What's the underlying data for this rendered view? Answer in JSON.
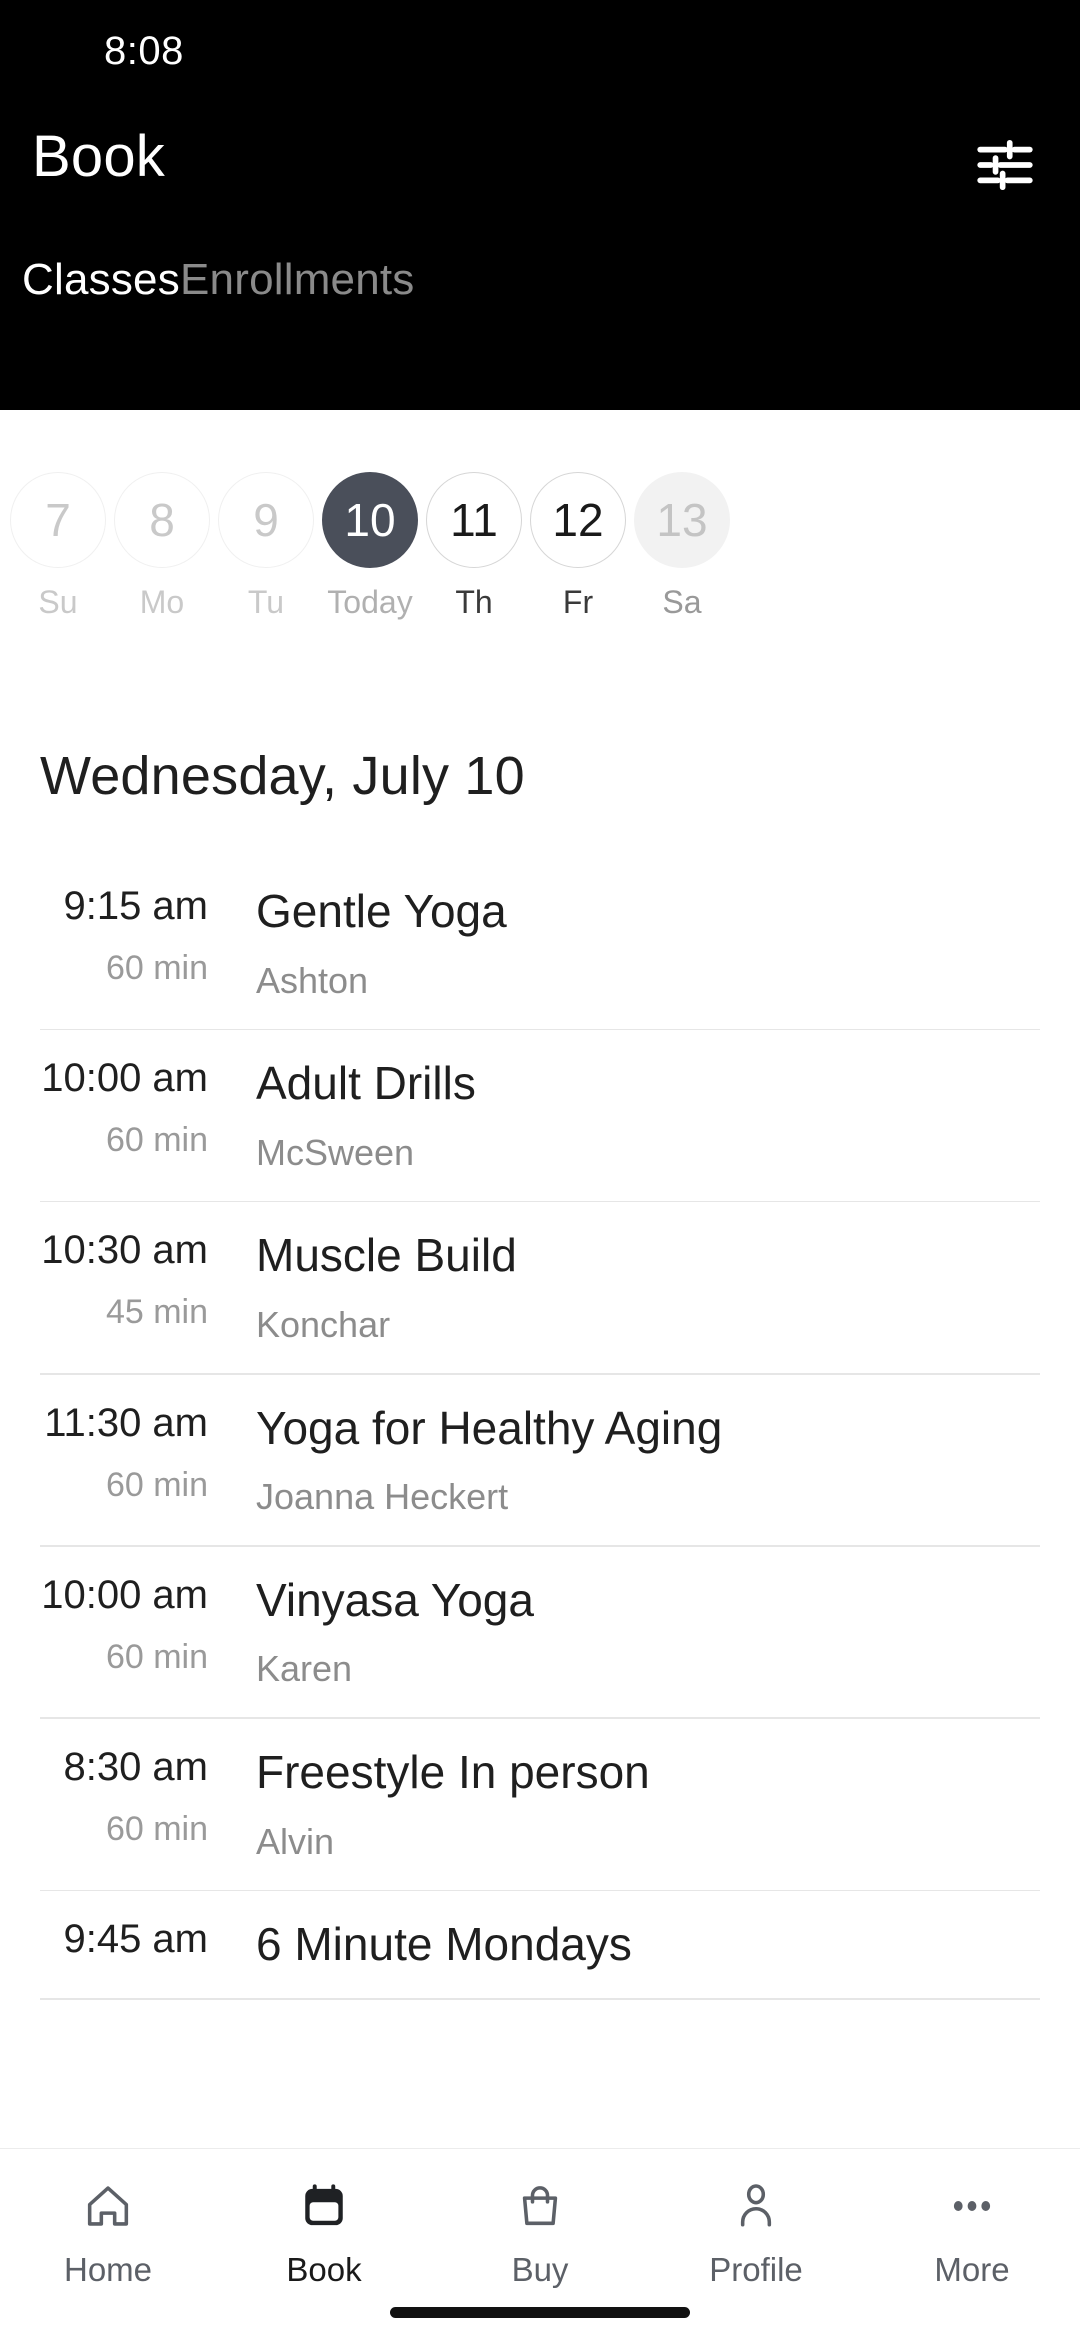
{
  "status_bar": {
    "time": "8:08"
  },
  "app_bar": {
    "title": "Book",
    "filter_icon": "tune-filter-icon"
  },
  "tabs": [
    {
      "label": "Classes",
      "active": true
    },
    {
      "label": "Enrollments",
      "active": false
    }
  ],
  "date_strip": {
    "days": [
      {
        "date": "7",
        "weekday": "Su",
        "state": "past"
      },
      {
        "date": "8",
        "weekday": "Mo",
        "state": "past"
      },
      {
        "date": "9",
        "weekday": "Tu",
        "state": "past"
      },
      {
        "date": "10",
        "weekday": "Today",
        "state": "today"
      },
      {
        "date": "11",
        "weekday": "Th",
        "state": "future"
      },
      {
        "date": "12",
        "weekday": "Fr",
        "state": "future"
      },
      {
        "date": "13",
        "weekday": "Sa",
        "state": "faded"
      }
    ]
  },
  "schedule": {
    "date_heading": "Wednesday, July 10",
    "classes": [
      {
        "time": "9:15 am",
        "duration": "60 min",
        "name": "Gentle Yoga",
        "teacher": "Ashton"
      },
      {
        "time": "10:00 am",
        "duration": "60 min",
        "name": "Adult Drills",
        "teacher": "McSween"
      },
      {
        "time": "10:30 am",
        "duration": "45 min",
        "name": "Muscle Build",
        "teacher": "Konchar"
      },
      {
        "time": "11:30 am",
        "duration": "60 min",
        "name": "Yoga for Healthy Aging",
        "teacher": "Joanna Heckert"
      },
      {
        "time": "10:00 am",
        "duration": "60 min",
        "name": "Vinyasa Yoga",
        "teacher": "Karen"
      },
      {
        "time": "8:30 am",
        "duration": "60 min",
        "name": "Freestyle In person",
        "teacher": "Alvin"
      },
      {
        "time": "9:45 am",
        "duration": "",
        "name": "6 Minute Mondays",
        "teacher": ""
      }
    ]
  },
  "bottom_nav": {
    "items": [
      {
        "label": "Home",
        "icon": "home-icon",
        "active": false
      },
      {
        "label": "Book",
        "icon": "calendar-icon",
        "active": true
      },
      {
        "label": "Buy",
        "icon": "bag-icon",
        "active": false
      },
      {
        "label": "Profile",
        "icon": "person-icon",
        "active": false
      },
      {
        "label": "More",
        "icon": "ellipsis-icon",
        "active": false
      }
    ]
  },
  "colors": {
    "header_bg": "#000000",
    "today_circle": "#4a4f5a",
    "muted_text": "#9a9a9a",
    "primary_text": "#1f1f1f"
  }
}
